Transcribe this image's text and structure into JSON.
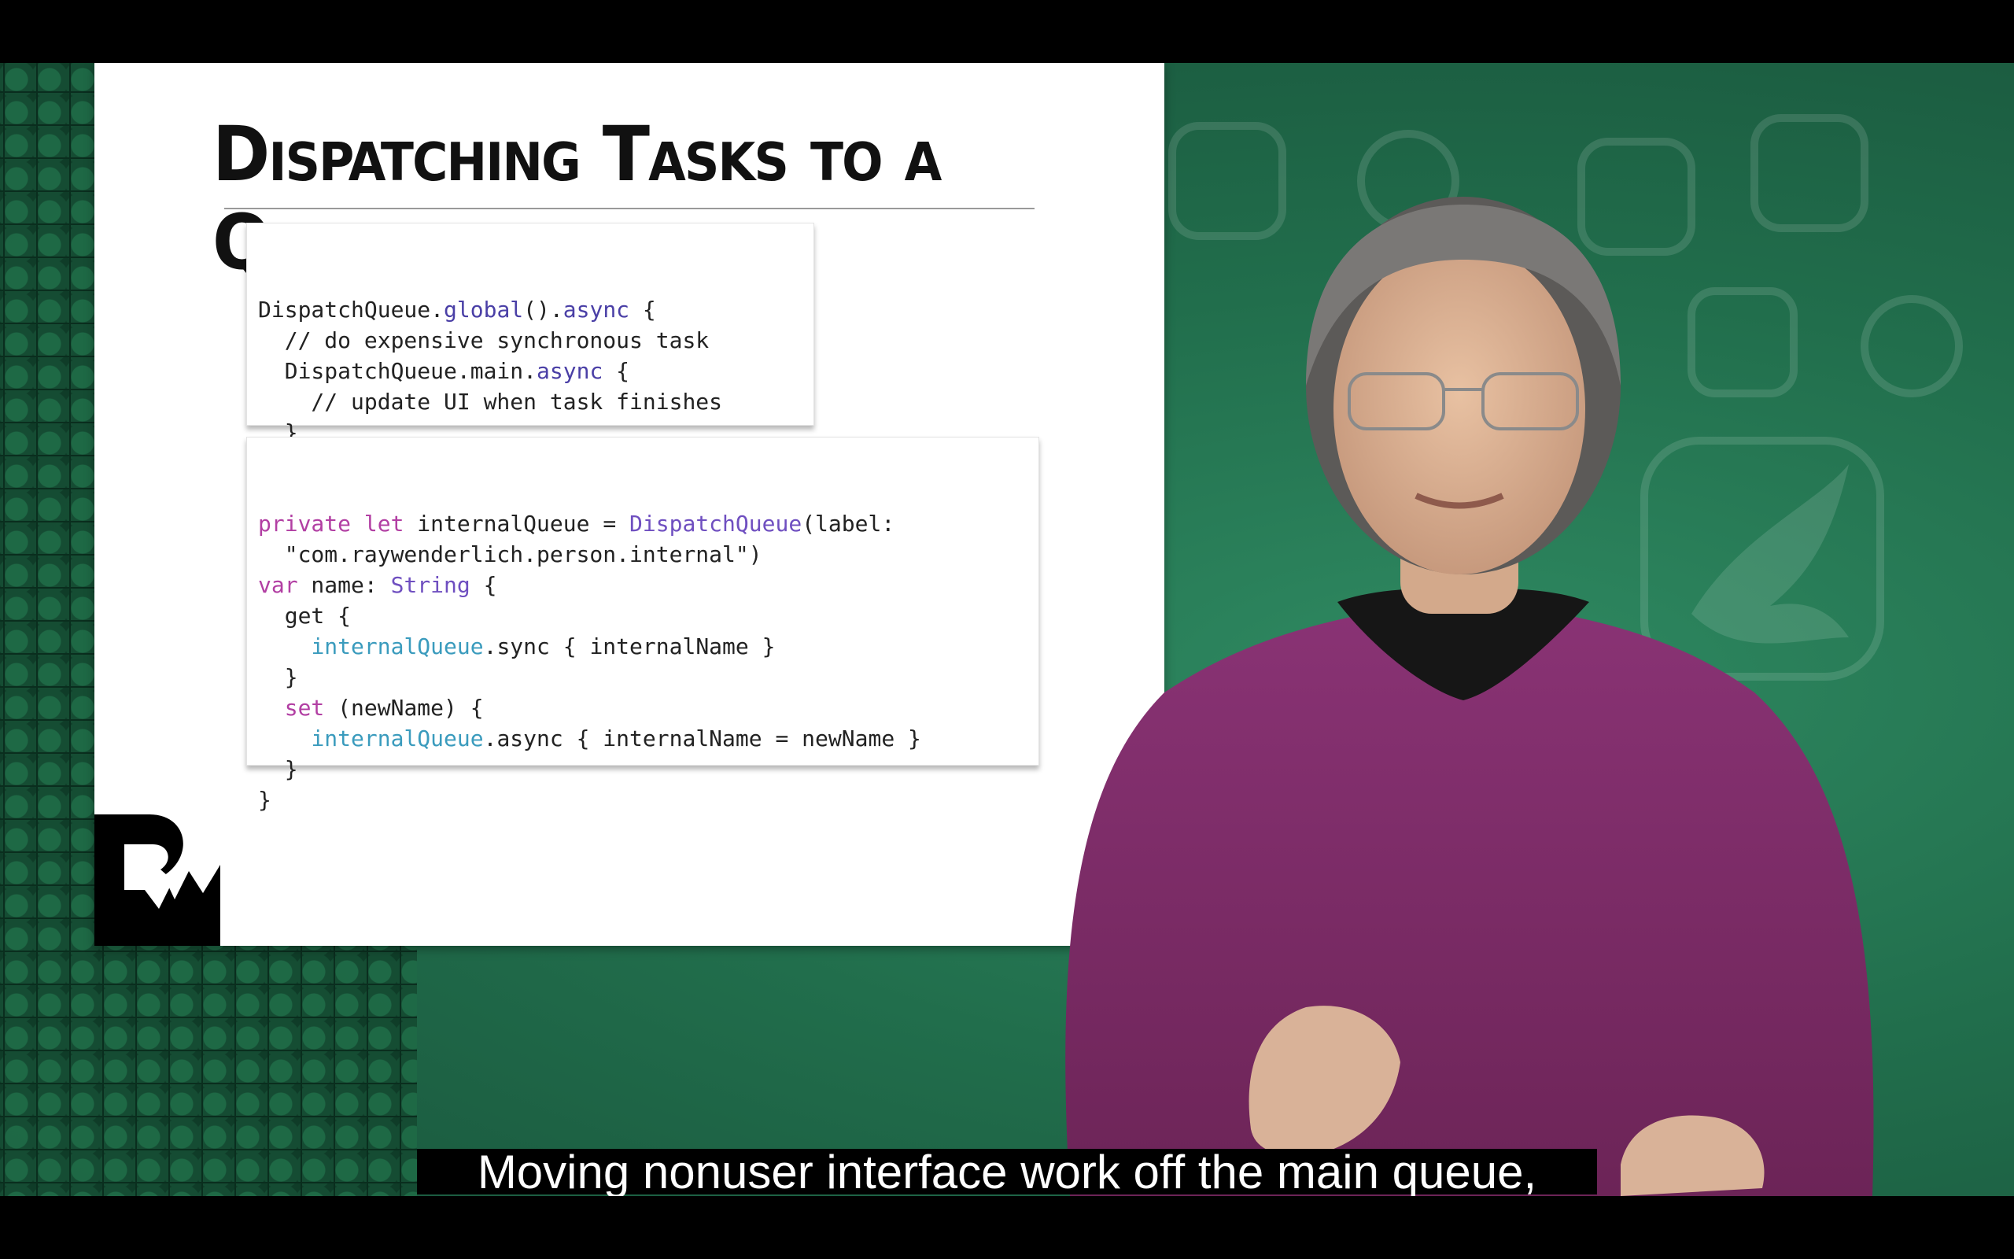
{
  "slide": {
    "title": "Dispatching Tasks to a Queue",
    "code_block_1": [
      [
        {
          "t": "DispatchQueue."
        },
        {
          "t": "global",
          "c": "fn"
        },
        {
          "t": "()."
        },
        {
          "t": "async",
          "c": "fn"
        },
        {
          "t": " {"
        }
      ],
      [
        {
          "t": "  // do expensive synchronous task"
        }
      ],
      [
        {
          "t": "  DispatchQueue.main."
        },
        {
          "t": "async",
          "c": "fn"
        },
        {
          "t": " {"
        }
      ],
      [
        {
          "t": "    // update UI when task finishes"
        }
      ],
      [
        {
          "t": "  }"
        }
      ],
      [
        {
          "t": "}"
        }
      ]
    ],
    "code_block_2": [
      [
        {
          "t": "private",
          "c": "kw"
        },
        {
          "t": " "
        },
        {
          "t": "let",
          "c": "kw"
        },
        {
          "t": " internalQueue = "
        },
        {
          "t": "DispatchQueue",
          "c": "ty"
        },
        {
          "t": "(label:"
        }
      ],
      [
        {
          "t": "  \"com.raywenderlich.person.internal\")"
        }
      ],
      [
        {
          "t": "var",
          "c": "kw"
        },
        {
          "t": " name: "
        },
        {
          "t": "String",
          "c": "ty"
        },
        {
          "t": " {"
        }
      ],
      [
        {
          "t": "  get {"
        }
      ],
      [
        {
          "t": "    "
        },
        {
          "t": "internalQueue",
          "c": "pr"
        },
        {
          "t": ".sync { internalName }"
        }
      ],
      [
        {
          "t": "  }"
        }
      ],
      [
        {
          "t": "  "
        },
        {
          "t": "set",
          "c": "kw"
        },
        {
          "t": " (newName) {"
        }
      ],
      [
        {
          "t": "    "
        },
        {
          "t": "internalQueue",
          "c": "pr"
        },
        {
          "t": ".async { internalName = newName }"
        }
      ],
      [
        {
          "t": "  }"
        }
      ],
      [
        {
          "t": "}"
        }
      ]
    ]
  },
  "caption": {
    "text": "Moving nonuser interface work off the main queue,"
  },
  "colors": {
    "background_green": "#216e4c",
    "sweater_purple": "#7a2a63",
    "keyword_pink": "#b23fa3",
    "function_purple": "#4a3fa6",
    "property_teal": "#3a9bbd"
  },
  "icons": {
    "logo": "raywenderlich-logo-icon",
    "background": "faint-app-icons"
  }
}
